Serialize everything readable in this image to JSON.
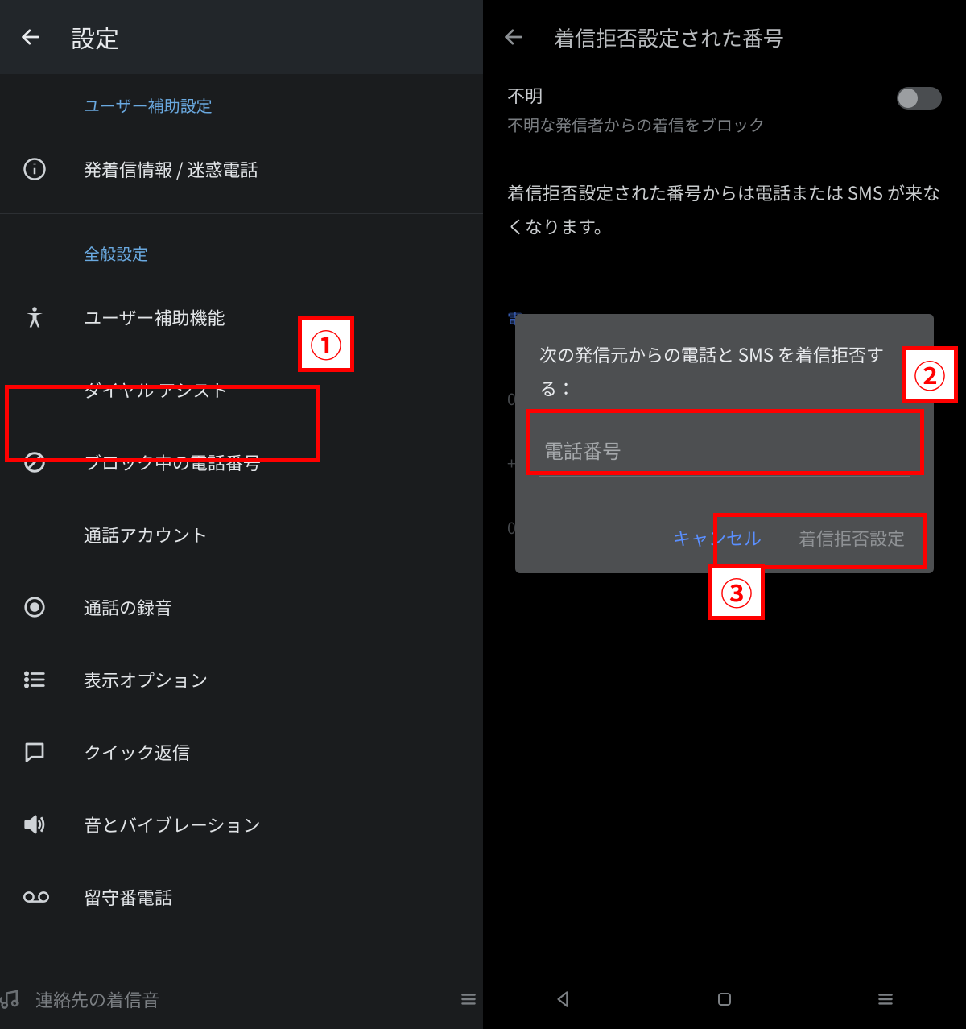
{
  "left": {
    "title": "設定",
    "sections": {
      "user_assist_header": "ユーザー補助設定",
      "caller_info": "発着信情報 / 迷惑電話",
      "general_header": "全般設定",
      "accessibility": "ユーザー補助機能",
      "dial_assist": "ダイヤル アシスト",
      "blocked_numbers": "ブロック中の電話番号",
      "call_accounts": "通話アカウント",
      "call_recording": "通話の録音",
      "display_options": "表示オプション",
      "quick_reply": "クイック返信",
      "sound_vibration": "音とバイブレーション",
      "voicemail": "留守番電話",
      "contact_ringtone": "連絡先の着信音"
    }
  },
  "right": {
    "title": "着信拒否設定された番号",
    "unknown_title": "不明",
    "unknown_sub": "不明な発信者からの着信をブロック",
    "info": "着信拒否設定された番号からは電話または SMS が来なくなります。",
    "faded_e": "電",
    "faded_zero_1": "0",
    "faded_plus": "+",
    "faded_zero_2": "0",
    "dialog": {
      "title": "次の発信元からの電話と SMS を着信拒否する：",
      "placeholder": "電話番号",
      "cancel": "キャンセル",
      "confirm": "着信拒否設定"
    }
  },
  "annotations": {
    "b1": "①",
    "b2": "②",
    "b3": "③"
  }
}
